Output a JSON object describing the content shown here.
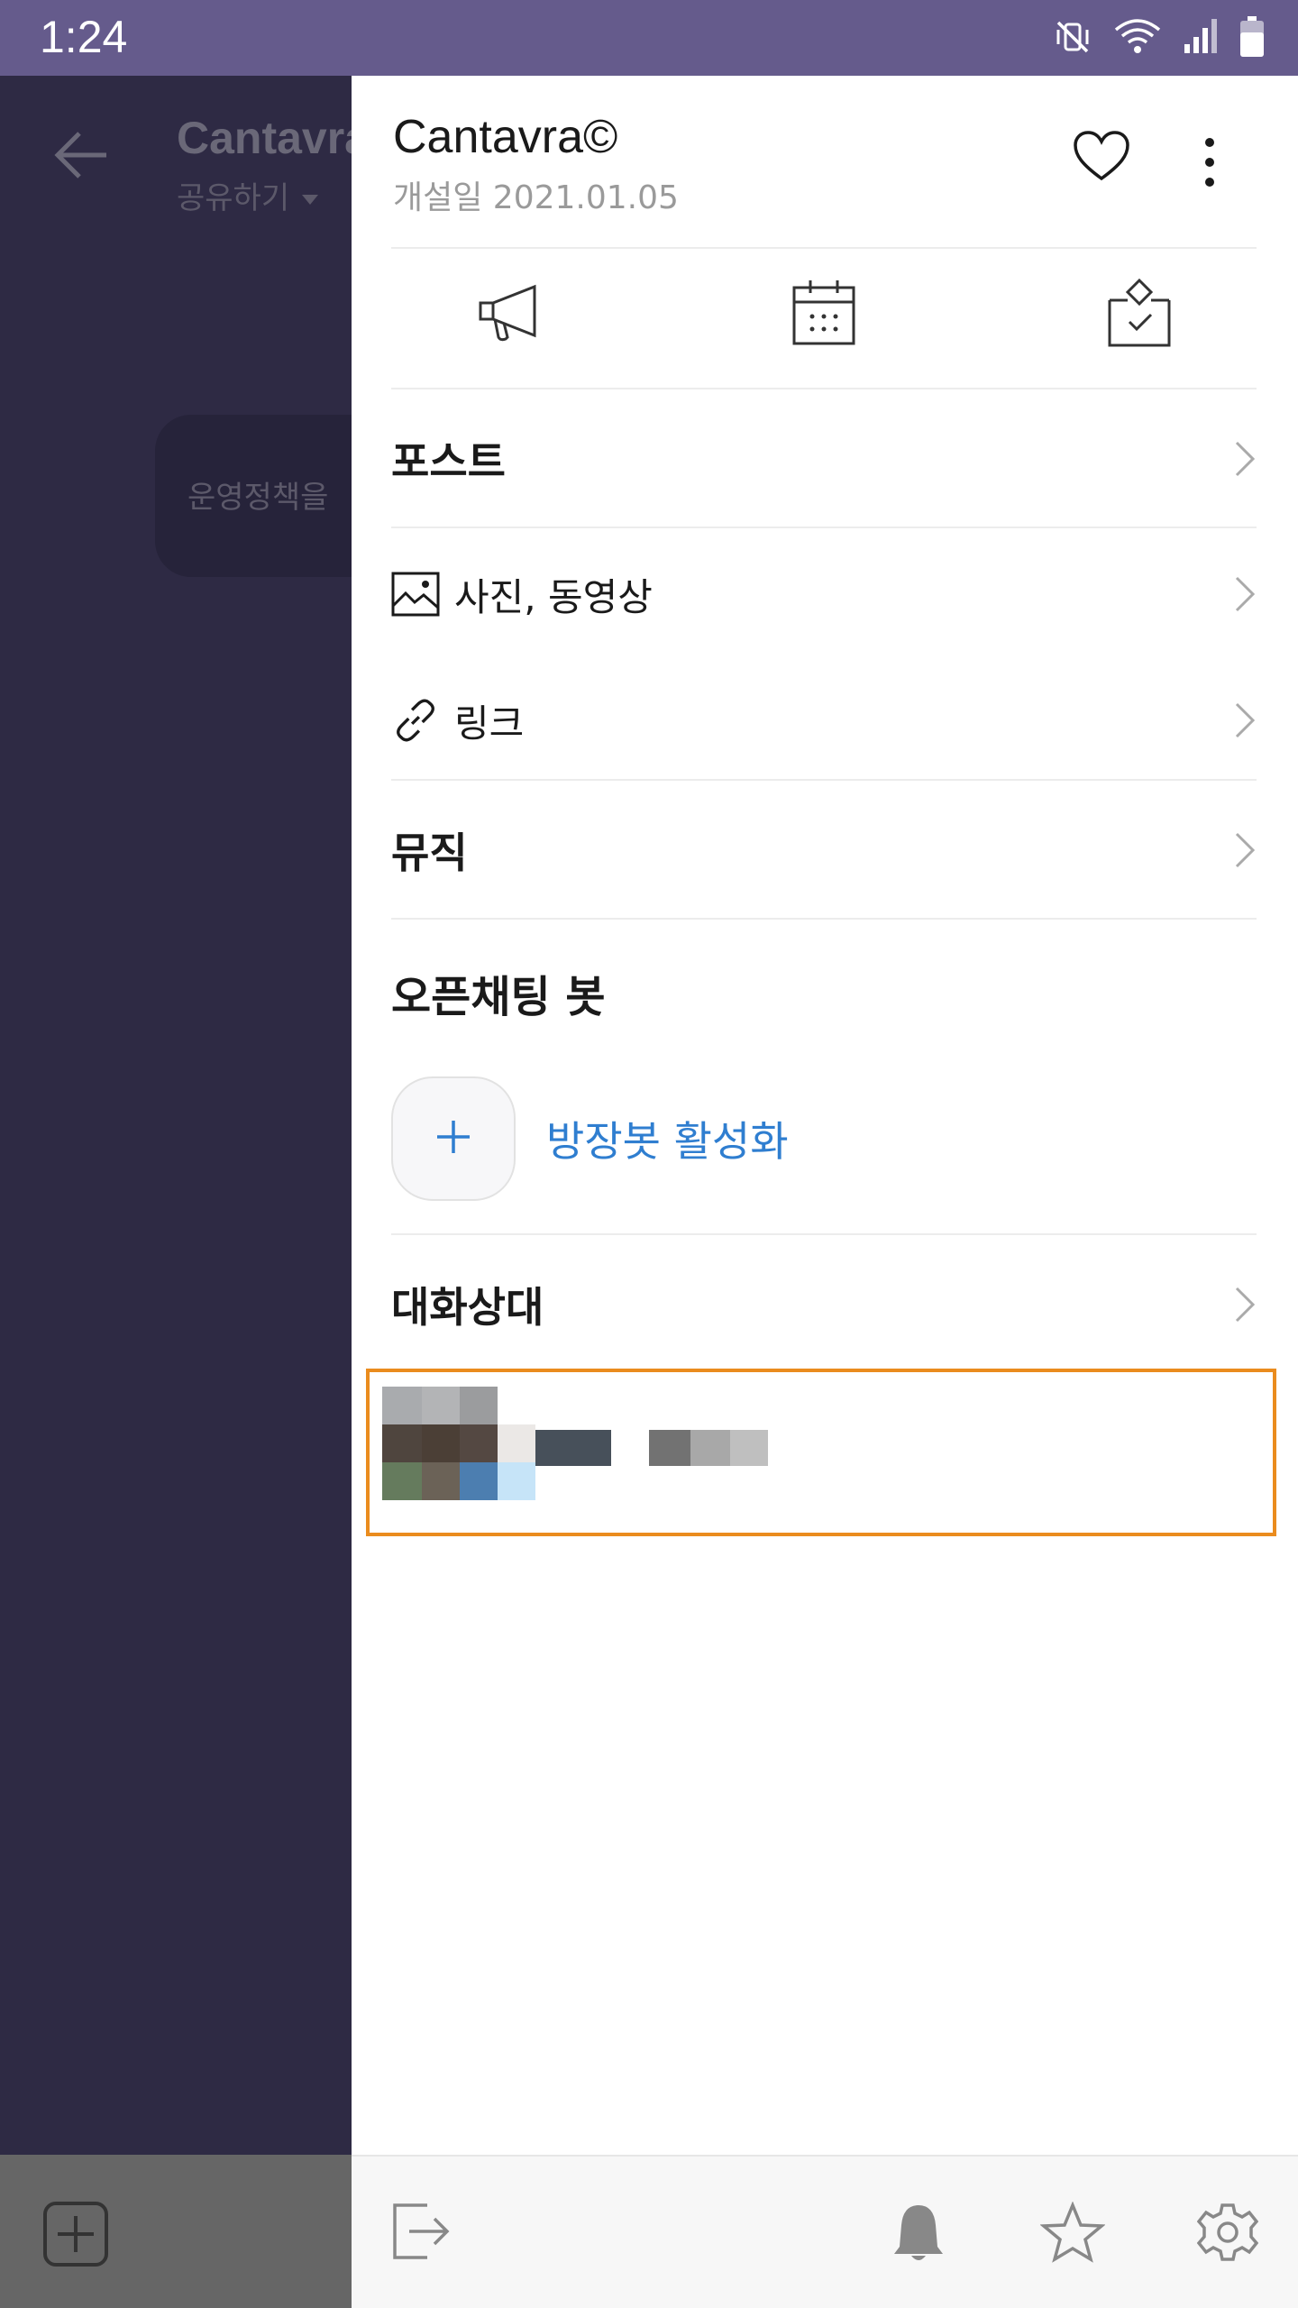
{
  "status_bar": {
    "time": "1:24",
    "icons": [
      "vibrate-mute-icon",
      "wifi-icon",
      "signal-icon",
      "battery-icon"
    ]
  },
  "background_chat": {
    "title": "Cantavra",
    "subtitle": "공유하기",
    "notice_text": "운영정책을"
  },
  "drawer": {
    "room_name": "Cantavra©",
    "created_date": "개설일 2021.01.05",
    "quick_actions": [
      "megaphone-icon",
      "calendar-icon",
      "vote-icon"
    ],
    "menu": {
      "posts": "포스트",
      "photos_videos": "사진, 동영상",
      "links": "링크",
      "music": "뮤직"
    },
    "bot_section_title": "오픈채팅 봇",
    "bot_activate_label": "방장봇 활성화",
    "members_title": "대화상대"
  },
  "bottom_bar_icons": [
    "exit-icon",
    "bell-icon",
    "star-icon",
    "settings-icon"
  ],
  "colors": {
    "status_bar": "#655b8c",
    "overlay": "#2e2a44",
    "link_blue": "#2f7ed0",
    "highlight_orange": "#ea8c1e"
  }
}
